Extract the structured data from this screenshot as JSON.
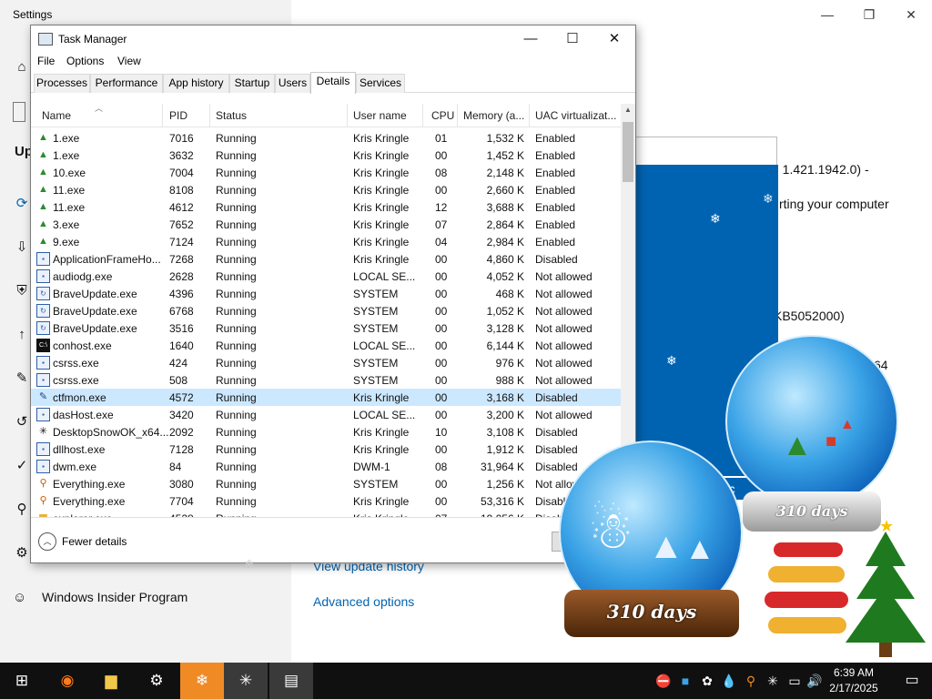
{
  "settings": {
    "window_title": "Settings",
    "section_label": "Up",
    "insider_program": "Windows Insider Program",
    "link_history": "View update history",
    "link_advanced": "Advanced options",
    "text_version": "n 1.421.1942.0) -",
    "text_restart": "rting your computer",
    "text_kb": "KB5052000)",
    "text_arch": "64"
  },
  "update_dialog": {
    "cancel_label": "Canc"
  },
  "task_manager": {
    "title": "Task Manager",
    "menu": [
      "File",
      "Options",
      "View"
    ],
    "tabs": [
      "Processes",
      "Performance",
      "App history",
      "Startup",
      "Users",
      "Details",
      "Services"
    ],
    "active_tab": "Details",
    "columns": [
      "Name",
      "PID",
      "Status",
      "User name",
      "CPU",
      "Memory (a...",
      "UAC virtualizat..."
    ],
    "rows": [
      {
        "icon": "tree-icon",
        "name": "1.exe",
        "pid": "7016",
        "status": "Running",
        "user": "Kris Kringle",
        "cpu": "01",
        "mem": "1,532 K",
        "uac": "Enabled"
      },
      {
        "icon": "tree-icon",
        "name": "1.exe",
        "pid": "3632",
        "status": "Running",
        "user": "Kris Kringle",
        "cpu": "00",
        "mem": "1,452 K",
        "uac": "Enabled"
      },
      {
        "icon": "tree-icon",
        "name": "10.exe",
        "pid": "7004",
        "status": "Running",
        "user": "Kris Kringle",
        "cpu": "08",
        "mem": "2,148 K",
        "uac": "Enabled"
      },
      {
        "icon": "tree-icon",
        "name": "11.exe",
        "pid": "8108",
        "status": "Running",
        "user": "Kris Kringle",
        "cpu": "00",
        "mem": "2,660 K",
        "uac": "Enabled"
      },
      {
        "icon": "tree-icon",
        "name": "11.exe",
        "pid": "4612",
        "status": "Running",
        "user": "Kris Kringle",
        "cpu": "12",
        "mem": "3,688 K",
        "uac": "Enabled"
      },
      {
        "icon": "tree-icon",
        "name": "3.exe",
        "pid": "7652",
        "status": "Running",
        "user": "Kris Kringle",
        "cpu": "07",
        "mem": "2,864 K",
        "uac": "Enabled"
      },
      {
        "icon": "tree-icon",
        "name": "9.exe",
        "pid": "7124",
        "status": "Running",
        "user": "Kris Kringle",
        "cpu": "04",
        "mem": "2,984 K",
        "uac": "Enabled"
      },
      {
        "icon": "window-icon",
        "name": "ApplicationFrameHo...",
        "pid": "7268",
        "status": "Running",
        "user": "Kris Kringle",
        "cpu": "00",
        "mem": "4,860 K",
        "uac": "Disabled"
      },
      {
        "icon": "window-icon",
        "name": "audiodg.exe",
        "pid": "2628",
        "status": "Running",
        "user": "LOCAL SE...",
        "cpu": "00",
        "mem": "4,052 K",
        "uac": "Not allowed"
      },
      {
        "icon": "brave-update-icon",
        "name": "BraveUpdate.exe",
        "pid": "4396",
        "status": "Running",
        "user": "SYSTEM",
        "cpu": "00",
        "mem": "468 K",
        "uac": "Not allowed"
      },
      {
        "icon": "brave-update-icon",
        "name": "BraveUpdate.exe",
        "pid": "6768",
        "status": "Running",
        "user": "SYSTEM",
        "cpu": "00",
        "mem": "1,052 K",
        "uac": "Not allowed"
      },
      {
        "icon": "brave-update-icon",
        "name": "BraveUpdate.exe",
        "pid": "3516",
        "status": "Running",
        "user": "SYSTEM",
        "cpu": "00",
        "mem": "3,128 K",
        "uac": "Not allowed"
      },
      {
        "icon": "console-icon",
        "name": "conhost.exe",
        "pid": "1640",
        "status": "Running",
        "user": "LOCAL SE...",
        "cpu": "00",
        "mem": "6,144 K",
        "uac": "Not allowed"
      },
      {
        "icon": "window-icon",
        "name": "csrss.exe",
        "pid": "424",
        "status": "Running",
        "user": "SYSTEM",
        "cpu": "00",
        "mem": "976 K",
        "uac": "Not allowed"
      },
      {
        "icon": "window-icon",
        "name": "csrss.exe",
        "pid": "508",
        "status": "Running",
        "user": "SYSTEM",
        "cpu": "00",
        "mem": "988 K",
        "uac": "Not allowed"
      },
      {
        "icon": "pen-icon",
        "name": "ctfmon.exe",
        "pid": "4572",
        "status": "Running",
        "user": "Kris Kringle",
        "cpu": "00",
        "mem": "3,168 K",
        "uac": "Disabled",
        "selected": true
      },
      {
        "icon": "window-icon",
        "name": "dasHost.exe",
        "pid": "3420",
        "status": "Running",
        "user": "LOCAL SE...",
        "cpu": "00",
        "mem": "3,200 K",
        "uac": "Not allowed"
      },
      {
        "icon": "snowflake-icon",
        "name": "DesktopSnowOK_x64...",
        "pid": "2092",
        "status": "Running",
        "user": "Kris Kringle",
        "cpu": "10",
        "mem": "3,108 K",
        "uac": "Disabled"
      },
      {
        "icon": "window-icon",
        "name": "dllhost.exe",
        "pid": "7128",
        "status": "Running",
        "user": "Kris Kringle",
        "cpu": "00",
        "mem": "1,912 K",
        "uac": "Disabled"
      },
      {
        "icon": "window-icon",
        "name": "dwm.exe",
        "pid": "84",
        "status": "Running",
        "user": "DWM-1",
        "cpu": "08",
        "mem": "31,964 K",
        "uac": "Disabled"
      },
      {
        "icon": "search-icon",
        "name": "Everything.exe",
        "pid": "3080",
        "status": "Running",
        "user": "SYSTEM",
        "cpu": "00",
        "mem": "1,256 K",
        "uac": "Not allow"
      },
      {
        "icon": "search-icon",
        "name": "Everything.exe",
        "pid": "7704",
        "status": "Running",
        "user": "Kris Kringle",
        "cpu": "00",
        "mem": "53,316 K",
        "uac": "Disable"
      },
      {
        "icon": "folder-icon",
        "name": "explorer.exe",
        "pid": "4528",
        "status": "Running",
        "user": "Kris Kringle",
        "cpu": "07",
        "mem": "19,056 K",
        "uac": "Disab"
      }
    ],
    "fewer_details": "Fewer details"
  },
  "globes": {
    "small_days": "310 days",
    "large_days": "310 days"
  },
  "taskbar": {
    "time": "6:39 AM",
    "date": "2/17/2025"
  }
}
